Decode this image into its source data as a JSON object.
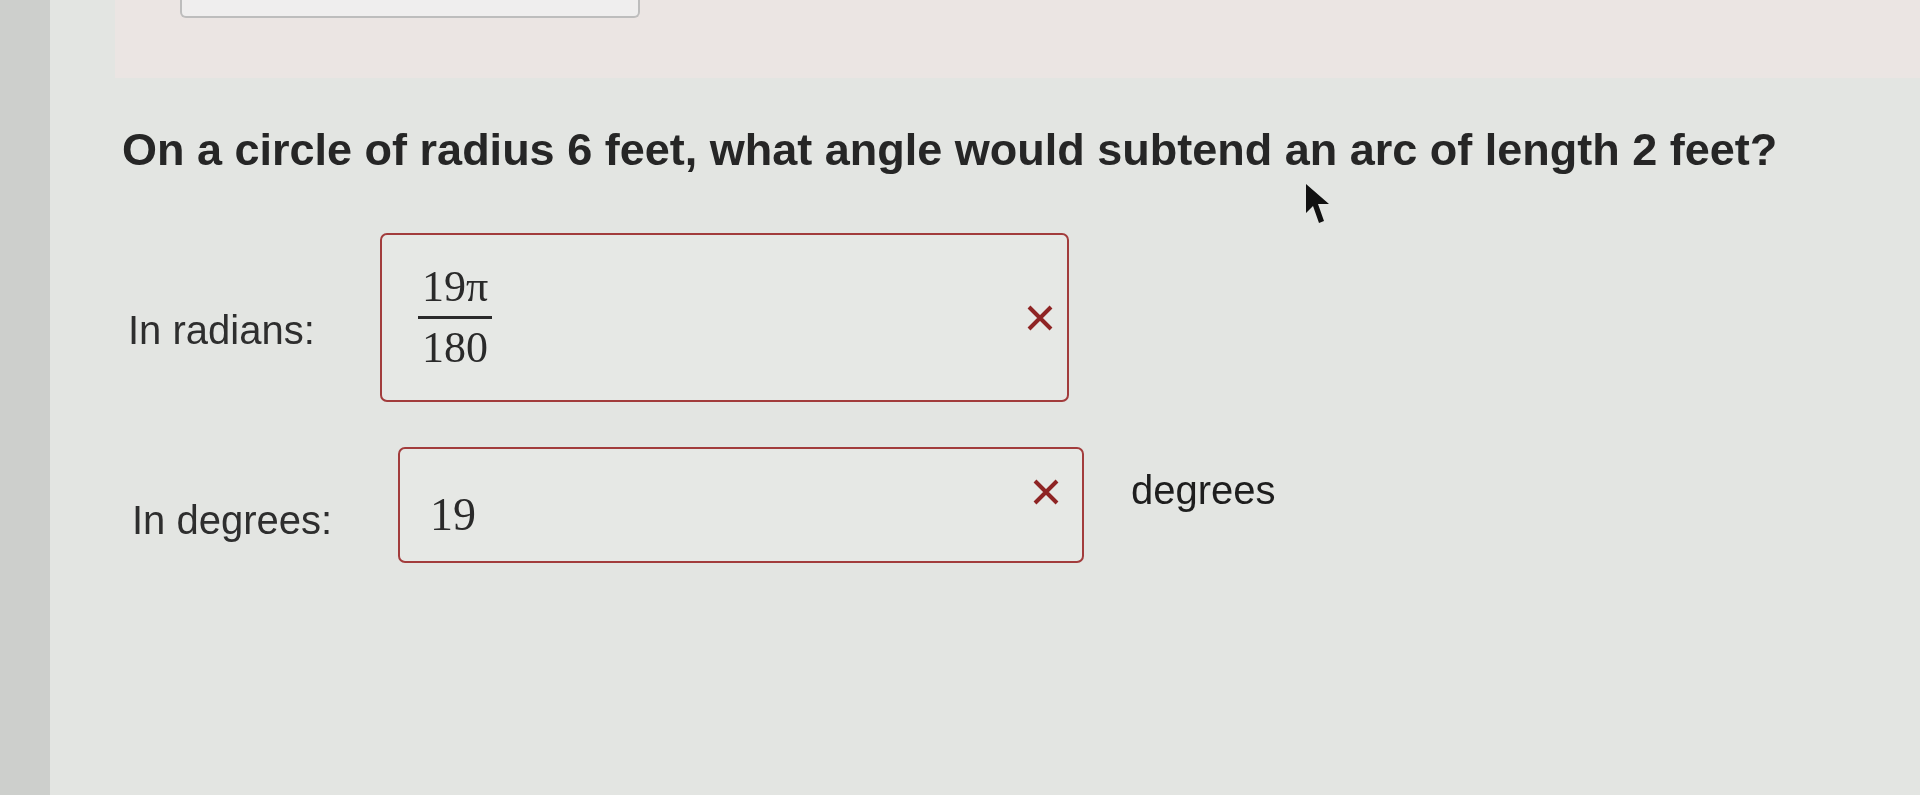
{
  "question": "On a circle of radius 6 feet, what angle would subtend an arc of length 2 feet?",
  "answers": [
    {
      "kind": "fraction",
      "label": "In radians:",
      "numerator": "19π",
      "denominator": "180",
      "correct": false
    },
    {
      "kind": "number",
      "label": "In degrees:",
      "value": "19",
      "unit": "degrees",
      "correct": false
    }
  ]
}
